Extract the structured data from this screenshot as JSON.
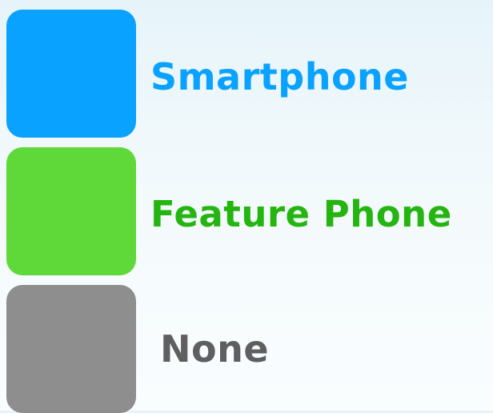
{
  "chart_data": {
    "type": "pie",
    "legend_position": "left",
    "legend": [
      {
        "name": "Smartphone",
        "color": "#0aa2ff",
        "text_color": "#0aa2ff"
      },
      {
        "name": "Feature Phone",
        "color": "#5fd93a",
        "text_color": "#25b510"
      },
      {
        "name": "None",
        "color": "#8e8e8e",
        "text_color": "#5f5f5f"
      }
    ]
  }
}
